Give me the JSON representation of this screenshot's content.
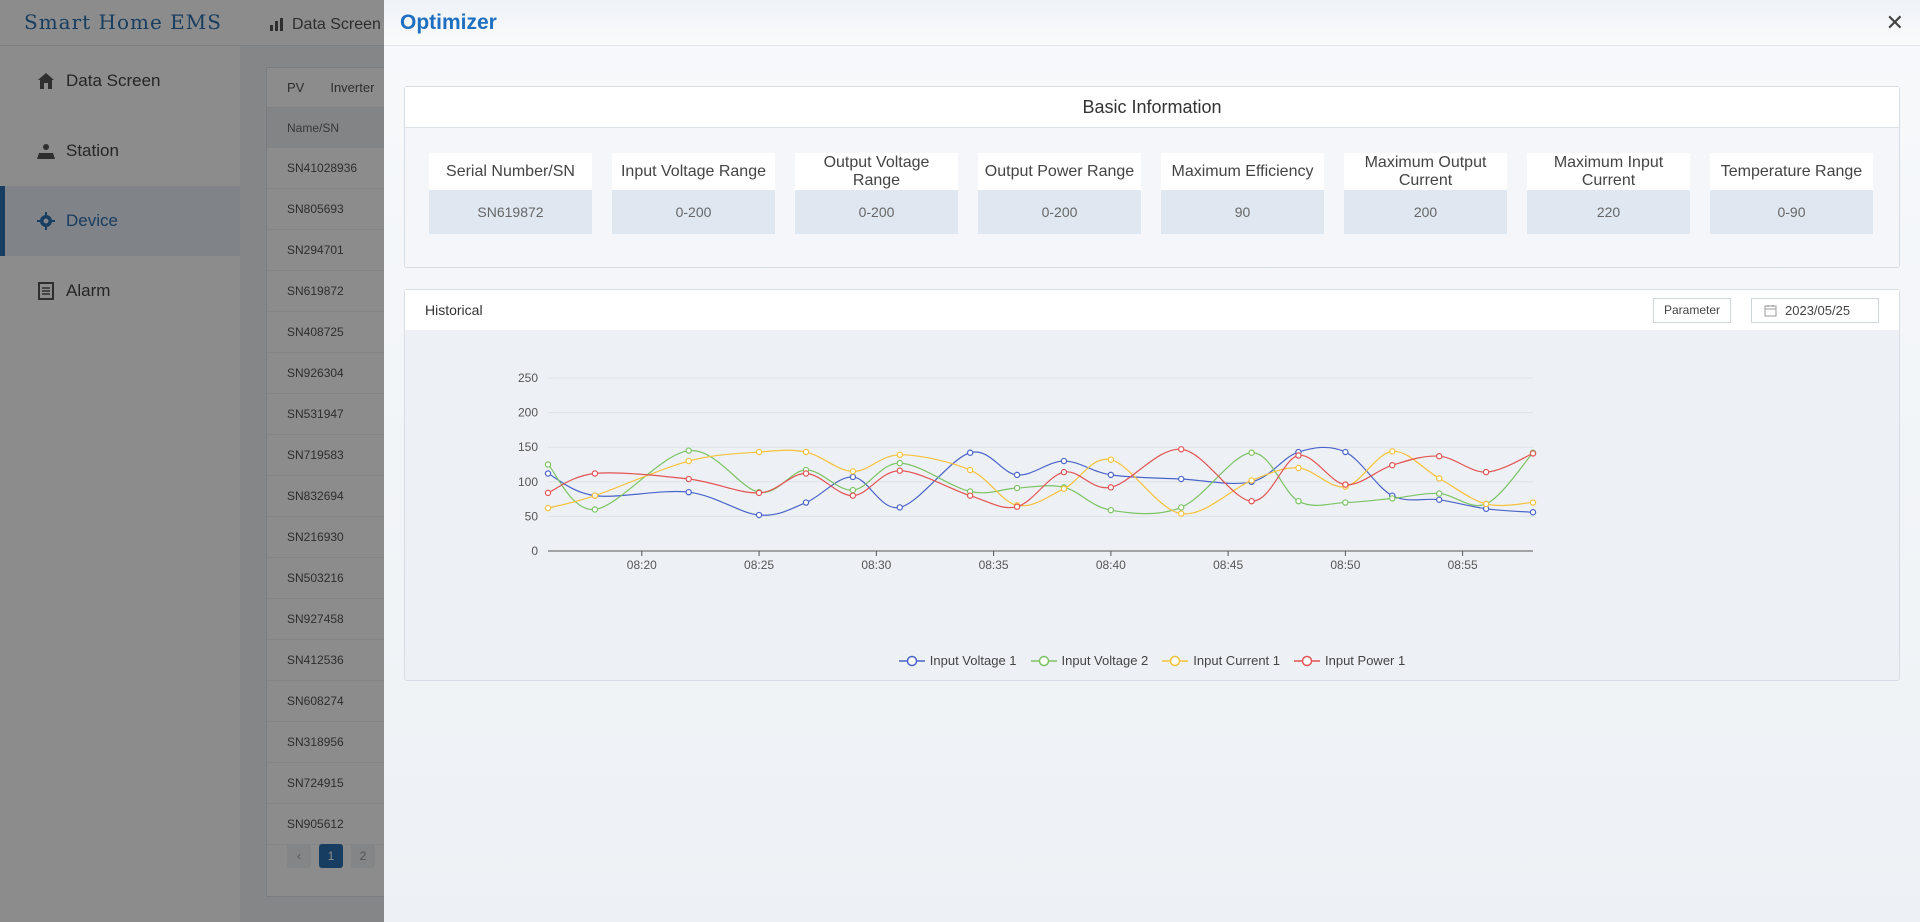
{
  "app": {
    "brand": "Smart Home EMS",
    "breadcrumb": "Data Screen",
    "sidebar": [
      {
        "label": "Data Screen",
        "icon": "home-icon"
      },
      {
        "label": "Station",
        "icon": "solar-station-icon"
      },
      {
        "label": "Device",
        "icon": "gear-icon"
      },
      {
        "label": "Alarm",
        "icon": "alarm-list-icon"
      }
    ],
    "tabs": [
      "PV",
      "Inverter"
    ],
    "list_header": "Name/SN",
    "rows": [
      "SN41028936",
      "SN805693",
      "SN294701",
      "SN619872",
      "SN408725",
      "SN926304",
      "SN531947",
      "SN719583",
      "SN832694",
      "SN216930",
      "SN503216",
      "SN927458",
      "SN412536",
      "SN608274",
      "SN318956",
      "SN724915",
      "SN905612"
    ],
    "pager": {
      "prev": "‹",
      "pages": [
        "1",
        "2"
      ]
    }
  },
  "drawer": {
    "title": "Optimizer",
    "close_icon": "close-icon",
    "basic_title": "Basic Information",
    "fields": [
      {
        "label": "Serial Number/SN",
        "value": "SN619872"
      },
      {
        "label": "Input Voltage Range",
        "value": "0-200"
      },
      {
        "label": "Output Voltage Range",
        "value": "0-200"
      },
      {
        "label": "Output Power Range",
        "value": "0-200"
      },
      {
        "label": "Maximum Efficiency",
        "value": "90"
      },
      {
        "label": "Maximum Output Current",
        "value": "200"
      },
      {
        "label": "Maximum Input Current",
        "value": "220"
      },
      {
        "label": "Temperature Range",
        "value": "0-90"
      }
    ],
    "historical_title": "Historical",
    "parameter_button": "Parameter",
    "date": "2023/05/25"
  },
  "chart_data": {
    "type": "line",
    "title": "",
    "xlabel": "",
    "ylabel": "",
    "x_start": "08:16",
    "x_end": "08:58",
    "x_ticks": [
      "08:20",
      "08:25",
      "08:30",
      "08:35",
      "08:40",
      "08:45",
      "08:50",
      "08:55"
    ],
    "y_ticks": [
      0,
      50,
      100,
      150,
      200,
      250
    ],
    "ylim": [
      0,
      250
    ],
    "grid": true,
    "legend_position": "bottom",
    "series": [
      {
        "name": "Input Voltage 1",
        "color": "#4a63c9",
        "x": [
          "08:16",
          "08:18",
          "08:22",
          "08:25",
          "08:27",
          "08:29",
          "08:31",
          "08:34",
          "08:36",
          "08:38",
          "08:40",
          "08:43",
          "08:46",
          "08:48",
          "08:50",
          "08:52",
          "08:54",
          "08:56",
          "08:58"
        ],
        "values": [
          112,
          80,
          85,
          52,
          70,
          107,
          63,
          142,
          110,
          130,
          110,
          104,
          100,
          143,
          143,
          80,
          74,
          61,
          56
        ]
      },
      {
        "name": "Input Voltage 2",
        "color": "#7cc364",
        "x": [
          "08:16",
          "08:18",
          "08:22",
          "08:25",
          "08:27",
          "08:29",
          "08:31",
          "08:34",
          "08:36",
          "08:38",
          "08:40",
          "08:43",
          "08:46",
          "08:48",
          "08:50",
          "08:52",
          "08:54",
          "08:56",
          "08:58"
        ],
        "values": [
          125,
          60,
          145,
          85,
          117,
          88,
          127,
          86,
          91,
          92,
          59,
          63,
          142,
          72,
          70,
          76,
          83,
          68,
          142
        ]
      },
      {
        "name": "Input Current 1",
        "color": "#f7c13b",
        "x": [
          "08:16",
          "08:18",
          "08:22",
          "08:25",
          "08:27",
          "08:29",
          "08:31",
          "08:34",
          "08:36",
          "08:38",
          "08:40",
          "08:43",
          "08:46",
          "08:48",
          "08:50",
          "08:52",
          "08:54",
          "08:56",
          "08:58"
        ],
        "values": [
          62,
          80,
          130,
          143,
          143,
          115,
          139,
          117,
          66,
          90,
          132,
          54,
          102,
          120,
          93,
          144,
          105,
          68,
          70
        ]
      },
      {
        "name": "Input Power 1",
        "color": "#e35353",
        "x": [
          "08:16",
          "08:18",
          "08:22",
          "08:25",
          "08:27",
          "08:29",
          "08:31",
          "08:34",
          "08:36",
          "08:38",
          "08:40",
          "08:43",
          "08:46",
          "08:48",
          "08:50",
          "08:52",
          "08:54",
          "08:56",
          "08:58"
        ],
        "values": [
          84,
          112,
          104,
          84,
          112,
          80,
          116,
          80,
          64,
          114,
          92,
          147,
          72,
          138,
          96,
          124,
          137,
          114,
          141
        ]
      }
    ]
  }
}
